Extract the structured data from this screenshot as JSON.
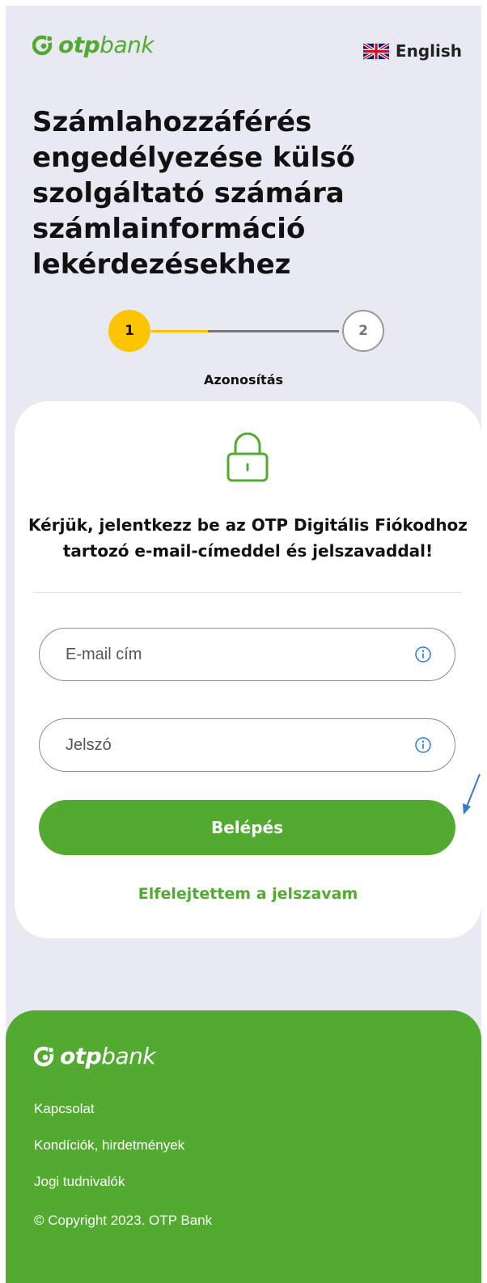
{
  "brand": {
    "logo_bold": "otp",
    "logo_light": "bank",
    "primary_color": "#52ab30",
    "accent_color": "#fbc600"
  },
  "header": {
    "language_label": "English",
    "flag_icon": "uk-flag-icon"
  },
  "page_title": "Számlahozzáférés engedélyezése külső szolgáltató számára számlainformáció lekérdezésekhez",
  "stepper": {
    "steps": [
      {
        "number": "1",
        "state": "active"
      },
      {
        "number": "2",
        "state": "inactive"
      }
    ],
    "active_label": "Azonosítás"
  },
  "login_card": {
    "lock_icon": "lock-icon",
    "instruction": "Kérjük, jelentkezz be az OTP Digitális Fiókodhoz tartozó e-mail-címeddel és jelszavaddal!",
    "email_placeholder": "E-mail cím",
    "email_value": "",
    "password_placeholder": "Jelszó",
    "password_value": "",
    "login_button": "Belépés",
    "forgot_password": "Elfelejtettem a jelszavam"
  },
  "footer": {
    "links": [
      "Kapcsolat",
      "Kondíciók, hirdetmények",
      "Jogi tudnivalók"
    ],
    "copyright": "© Copyright 2023. OTP Bank"
  }
}
